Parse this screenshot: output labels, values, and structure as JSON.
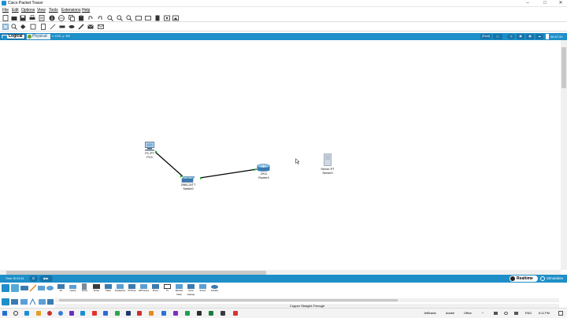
{
  "window": {
    "title": "Cisco Packet Tracer",
    "minimize": "–",
    "maximize": "□",
    "close": "✕"
  },
  "menu": [
    "File",
    "Edit",
    "Options",
    "View",
    "Tools",
    "Extensions",
    "Help"
  ],
  "modebar": {
    "logical": "Logical",
    "physical": "Physical",
    "coords": "x: 1001, y: 399",
    "root": "[Root]",
    "clock": "06:47:20"
  },
  "devices": {
    "pc": {
      "type": "PC-PT",
      "name": "PC0"
    },
    "switch": {
      "type": "2960-24TT",
      "name": "Switch0"
    },
    "router": {
      "type": "2911",
      "name": "Router0"
    },
    "server": {
      "type": "Server-PT",
      "name": "Server0"
    }
  },
  "timebar": {
    "time": "Time: 00:13:34",
    "realtime": "Realtime",
    "simulation": "Simulation"
  },
  "device_panel": {
    "device_labels": [
      "PC",
      "Laptop",
      "Server",
      "Printer",
      "Tablet",
      "Smartphone",
      "IP Phone",
      "VoIP Device",
      "Phone",
      "TV",
      "Wireless Tablet",
      "Home Gateway",
      "Sensor",
      "Actuator"
    ],
    "cable_label": "Copper Straight-Through"
  },
  "taskbar": {
    "items": [
      "JetBrains",
      "Adobe",
      "Office"
    ],
    "chevron": "^",
    "lang": "ENG",
    "time": "6:11 PM"
  },
  "colors": {
    "accent": "#1e8fc8",
    "link_up": "#22bb33"
  }
}
